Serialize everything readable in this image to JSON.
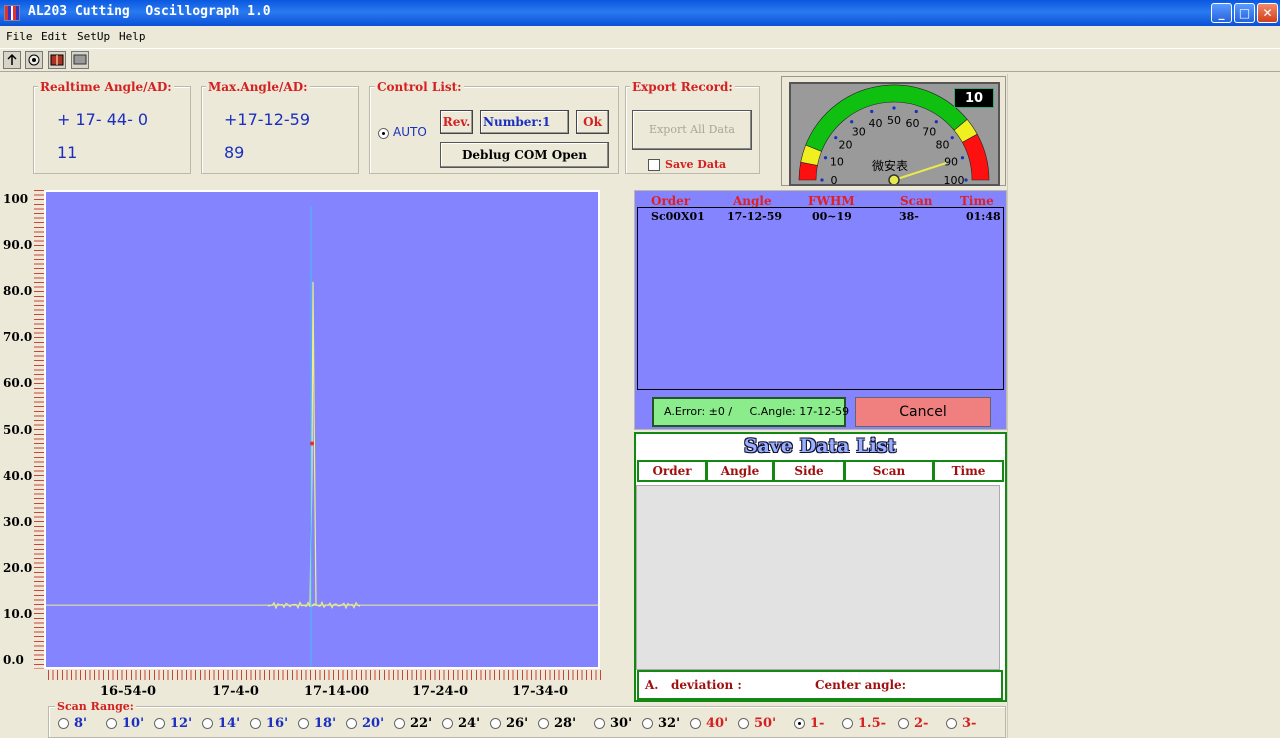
{
  "window": {
    "title": "AL203 Cutting  Oscillograph 1.0",
    "controls": {
      "minimize": "_",
      "maximize": "□",
      "close": "✕"
    }
  },
  "menu": [
    "File",
    "Edit",
    "SetUp",
    "Help"
  ],
  "toolbar": [
    "upload-icon",
    "settings-icon",
    "book-icon",
    "monitor-icon"
  ],
  "realtime": {
    "title": "Realtime Angle/AD:",
    "angle": "+ 17- 44- 0",
    "ad": "11"
  },
  "max": {
    "title": "Max.Angle/AD:",
    "angle": "+17-12-59",
    "ad": "89"
  },
  "control": {
    "title": "Control List:",
    "auto": "AUTO",
    "rev": "Rev.",
    "number": "Number:1",
    "ok": "Ok",
    "debug": "Deblug COM Open"
  },
  "export": {
    "title": "Export  Record:",
    "button": "Export  All Data",
    "save": "Save  Data"
  },
  "gauge": {
    "display": "10",
    "label": "微安表",
    "value": 10,
    "ticks": [
      "0",
      "10",
      "20",
      "30",
      "40",
      "50",
      "60",
      "70",
      "80",
      "90",
      "100"
    ]
  },
  "chart_data": {
    "type": "line",
    "ylim": [
      0,
      100
    ],
    "y_ticks": [
      "100",
      "90.0",
      "80.0",
      "70.0",
      "60.0",
      "50.0",
      "40.0",
      "30.0",
      "20.0",
      "10.0",
      "0.0"
    ],
    "x_ticks": [
      "16-54-0",
      "17-4-0",
      "17-14-00",
      "17-24-0",
      "17-34-0"
    ],
    "series": [
      {
        "baseline": 10,
        "peak_position": "between 17-4-0 and 17-14-00",
        "peak": 82
      }
    ],
    "colors": {
      "background": "#8484ff",
      "line": "#f0f080",
      "cursor": "#40c0ff"
    }
  },
  "records": {
    "columns": [
      "Order",
      "Angle",
      "FWHM",
      "Scan",
      "Time"
    ],
    "rows": [
      [
        "Sc00X01",
        "17-12-59",
        "00~19",
        "38-",
        "01:48"
      ]
    ]
  },
  "status": {
    "text": "A.Error: ±0 /     C.Angle: 17-12-59",
    "cancel": "Cancel"
  },
  "save_list": {
    "title": "Save Data List",
    "columns": [
      "Order",
      "Angle",
      "Side",
      "Scan",
      "Time"
    ],
    "deviation": "A.   deviation :",
    "center": "Center angle:"
  },
  "scan_range": {
    "title": "Scan Range:",
    "options": [
      {
        "label": "8'",
        "color": "#1a2fc0"
      },
      {
        "label": "10'",
        "color": "#1a2fc0"
      },
      {
        "label": "12'",
        "color": "#1a2fc0"
      },
      {
        "label": "14'",
        "color": "#1a2fc0"
      },
      {
        "label": "16'",
        "color": "#1a2fc0"
      },
      {
        "label": "18'",
        "color": "#1a2fc0"
      },
      {
        "label": "20'",
        "color": "#1a2fc0"
      },
      {
        "label": "22'",
        "color": "#000000"
      },
      {
        "label": "24'",
        "color": "#000000"
      },
      {
        "label": "26'",
        "color": "#000000"
      },
      {
        "label": "28'",
        "color": "#000000"
      },
      {
        "label": "30'",
        "color": "#000000"
      },
      {
        "label": "32'",
        "color": "#000000"
      },
      {
        "label": "40'",
        "color": "#d42020"
      },
      {
        "label": "50'",
        "color": "#d42020"
      },
      {
        "label": "1-",
        "color": "#d42020",
        "selected": true
      },
      {
        "label": "1.5-",
        "color": "#d42020"
      },
      {
        "label": "2-",
        "color": "#d42020"
      },
      {
        "label": "3-",
        "color": "#d42020"
      }
    ]
  }
}
